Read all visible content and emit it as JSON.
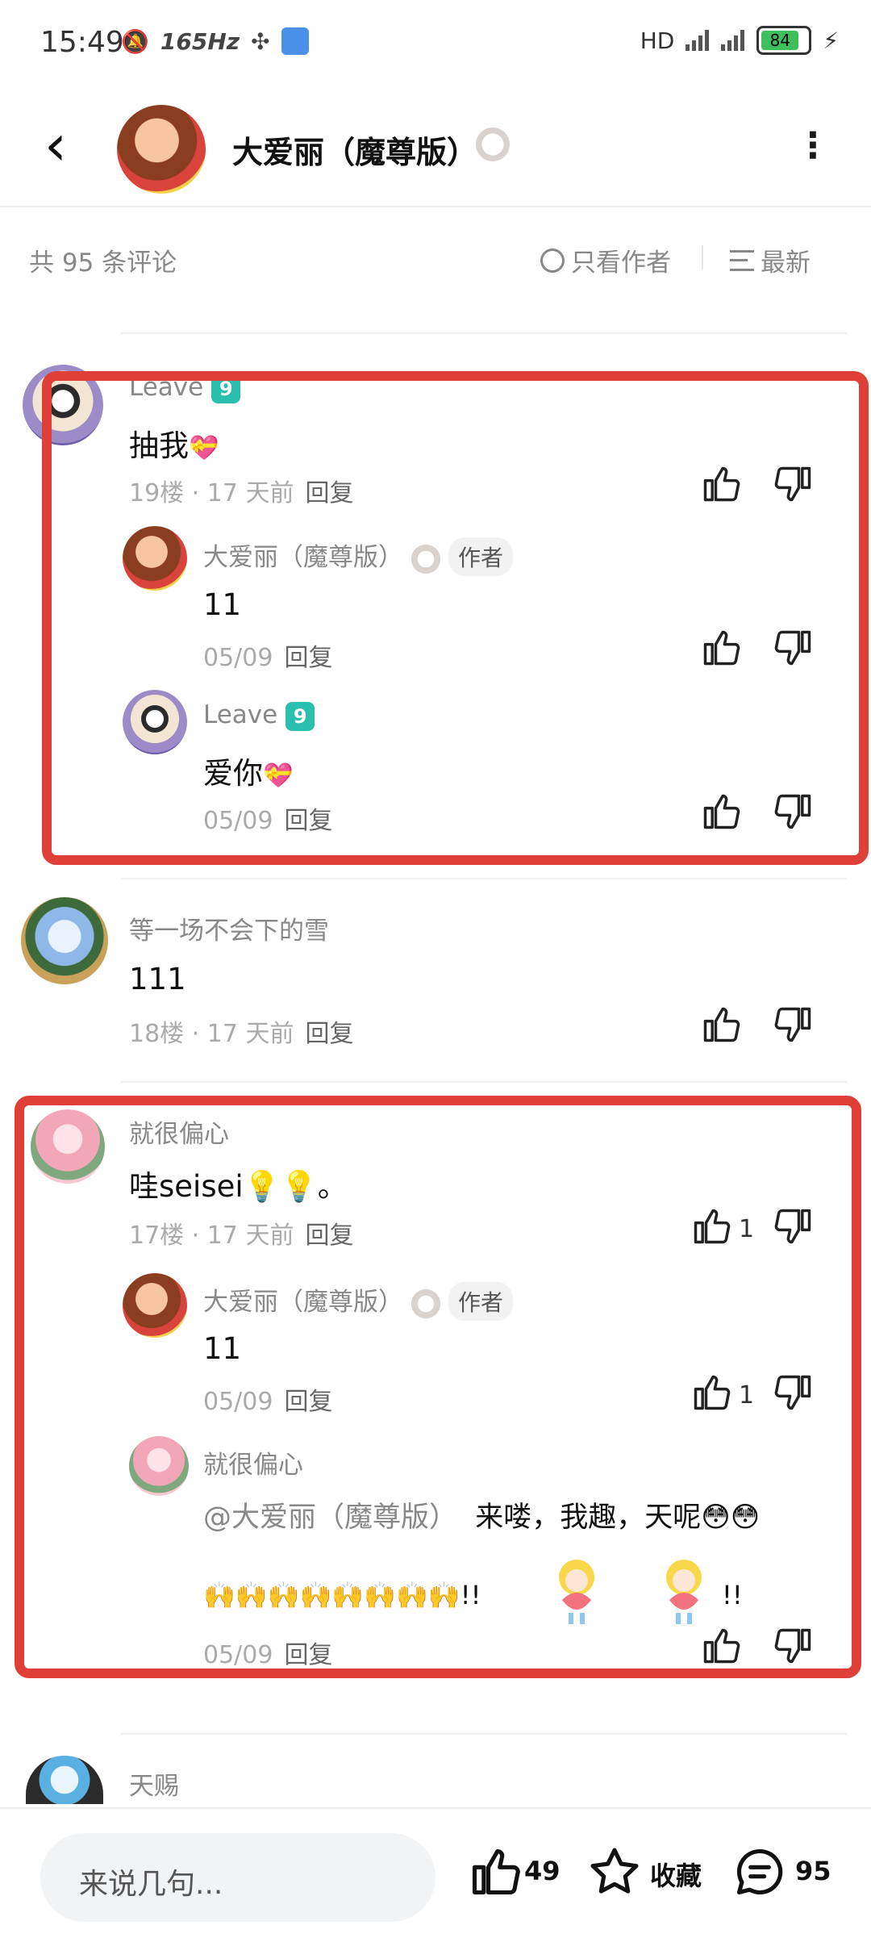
{
  "status_bar": {
    "time": "15:49",
    "refresh": "165Hz",
    "network": "HD",
    "battery": "84"
  },
  "header": {
    "title": "大爱丽（魔尊版）"
  },
  "list_bar": {
    "count_text": "共 95 条评论",
    "only_author": "只看作者",
    "sort": "最新"
  },
  "comments": [
    {
      "username": "Leave",
      "level": "9",
      "text": "抽我",
      "floor": "19楼 · 17 天前",
      "reply": "回复",
      "replies": [
        {
          "username": "大爱丽（魔尊版）",
          "tag": "作者",
          "text": "11",
          "date": "05/09",
          "reply": "回复"
        },
        {
          "username": "Leave",
          "level": "9",
          "text": "爱你",
          "date": "05/09",
          "reply": "回复"
        }
      ]
    },
    {
      "username": "等一场不会下的雪",
      "text": "111",
      "floor": "18楼 · 17 天前",
      "reply": "回复"
    },
    {
      "username": "就很偏心",
      "text": "哇seisei💡💡。",
      "floor": "17楼 · 17 天前",
      "reply": "回复",
      "likes": "1",
      "replies": [
        {
          "username": "大爱丽（魔尊版）",
          "tag": "作者",
          "text": "11",
          "date": "05/09",
          "reply": "回复",
          "likes": "1"
        },
        {
          "username": "就很偏心",
          "mention": "@大爱丽（魔尊版）",
          "text": "来喽，我趣，天呢😳😳",
          "text2": "🙌🙌🙌🙌🙌🙌🙌🙌!!",
          "text3": "!!",
          "date": "05/09",
          "reply": "回复"
        }
      ]
    },
    {
      "username": "天赐"
    }
  ],
  "bottom_bar": {
    "placeholder": "来说几句...",
    "likes": "49",
    "collect": "收藏",
    "comments": "95"
  },
  "colors": {
    "highlight_box": "#df3f36",
    "level_badge": "#2bbfae"
  }
}
